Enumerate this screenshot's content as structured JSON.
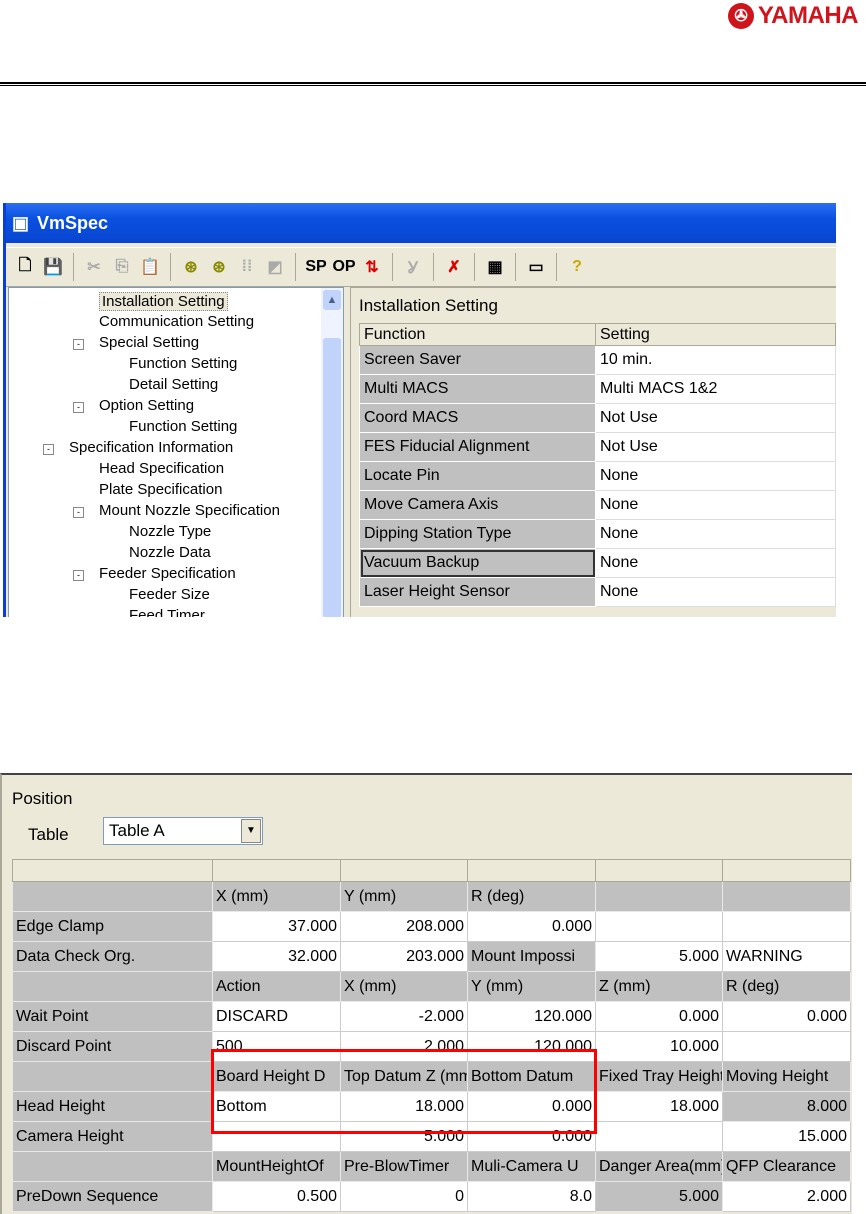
{
  "logo": {
    "text": "YAMAHA"
  },
  "window": {
    "title": "VmSpec"
  },
  "toolbar": {
    "sp": "SP",
    "op": "OP"
  },
  "tree": [
    {
      "label": "Installation Setting",
      "level": 2,
      "selected": true
    },
    {
      "label": "Communication Setting",
      "level": 2
    },
    {
      "label": "Special Setting",
      "level": 2,
      "expander": "-"
    },
    {
      "label": "Function Setting",
      "level": 3
    },
    {
      "label": "Detail Setting",
      "level": 3
    },
    {
      "label": "Option Setting",
      "level": 2,
      "expander": "-"
    },
    {
      "label": "Function Setting",
      "level": 3
    },
    {
      "label": "Specification Information",
      "level": 1,
      "expander": "-"
    },
    {
      "label": "Head Specification",
      "level": 2
    },
    {
      "label": "Plate Specification",
      "level": 2
    },
    {
      "label": "Mount Nozzle Specification",
      "level": 2,
      "expander": "-"
    },
    {
      "label": "Nozzle Type",
      "level": 3
    },
    {
      "label": "Nozzle Data",
      "level": 3
    },
    {
      "label": "Feeder Specification",
      "level": 2,
      "expander": "-"
    },
    {
      "label": "Feeder Size",
      "level": 3
    },
    {
      "label": "Feed Timer",
      "level": 3
    }
  ],
  "settings": {
    "title": "Installation Setting",
    "headers": [
      "Function",
      "Setting"
    ],
    "rows": [
      [
        "Screen Saver",
        "10 min."
      ],
      [
        "Multi MACS",
        "Multi MACS 1&2"
      ],
      [
        "Coord MACS",
        "Not Use"
      ],
      [
        "FES Fiducial Alignment",
        "Not Use"
      ],
      [
        "Locate Pin",
        "None"
      ],
      [
        "Move Camera Axis",
        "None"
      ],
      [
        "Dipping Station Type",
        "None"
      ],
      [
        "Vacuum Backup",
        "None"
      ],
      [
        "Laser Height Sensor",
        "None"
      ]
    ]
  },
  "position": {
    "title": "Position",
    "table_label": "Table",
    "table_value": "Table A",
    "grid": [
      [
        [
          "",
          "g"
        ],
        [
          "X (mm)",
          "g"
        ],
        [
          "Y (mm)",
          "g"
        ],
        [
          "R (deg)",
          "g"
        ],
        [
          "",
          "g"
        ],
        [
          "",
          "g"
        ]
      ],
      [
        [
          "Edge Clamp",
          "g"
        ],
        [
          "37.000",
          "wr"
        ],
        [
          "208.000",
          "wr"
        ],
        [
          "0.000",
          "wr"
        ],
        [
          "",
          "w"
        ],
        [
          "",
          "w"
        ]
      ],
      [
        [
          "Data Check Org.",
          "g"
        ],
        [
          "32.000",
          "wr"
        ],
        [
          "203.000",
          "wr"
        ],
        [
          "Mount Impossi",
          "g"
        ],
        [
          "5.000",
          "wr"
        ],
        [
          "WARNING",
          "w"
        ]
      ],
      [
        [
          "",
          "g"
        ],
        [
          "Action",
          "g"
        ],
        [
          "X (mm)",
          "g"
        ],
        [
          "Y (mm)",
          "g"
        ],
        [
          "Z (mm)",
          "g"
        ],
        [
          "R (deg)",
          "g"
        ]
      ],
      [
        [
          "Wait Point",
          "g"
        ],
        [
          "DISCARD",
          "w"
        ],
        [
          "-2.000",
          "wr"
        ],
        [
          "120.000",
          "wr"
        ],
        [
          "0.000",
          "wr"
        ],
        [
          "0.000",
          "wr"
        ]
      ],
      [
        [
          "Discard Point",
          "g"
        ],
        [
          "500",
          "w"
        ],
        [
          "2.000",
          "wr"
        ],
        [
          "120.000",
          "wr"
        ],
        [
          "10.000",
          "wr"
        ],
        [
          "",
          "w"
        ]
      ],
      [
        [
          "",
          "g"
        ],
        [
          "Board Height D",
          "g"
        ],
        [
          "Top Datum Z (mm)",
          "g"
        ],
        [
          "Bottom Datum",
          "g"
        ],
        [
          "Fixed Tray Height",
          "g"
        ],
        [
          "Moving Height",
          "g"
        ]
      ],
      [
        [
          "Head Height",
          "g"
        ],
        [
          "Bottom",
          "w"
        ],
        [
          "18.000",
          "wr"
        ],
        [
          "0.000",
          "wr"
        ],
        [
          "18.000",
          "wr"
        ],
        [
          "8.000",
          "gr"
        ]
      ],
      [
        [
          "Camera Height",
          "g"
        ],
        [
          "",
          "w"
        ],
        [
          "5.000",
          "wr"
        ],
        [
          "0.000",
          "wr"
        ],
        [
          "",
          "w"
        ],
        [
          "15.000",
          "wr"
        ]
      ],
      [
        [
          "",
          "g"
        ],
        [
          "MountHeightOf",
          "g"
        ],
        [
          "Pre-BlowTimer",
          "g"
        ],
        [
          "Muli-Camera U",
          "g"
        ],
        [
          "Danger Area(mm)",
          "g"
        ],
        [
          "QFP Clearance",
          "g"
        ]
      ],
      [
        [
          "PreDown Sequence",
          "g"
        ],
        [
          "0.500",
          "wr"
        ],
        [
          "0",
          "wr"
        ],
        [
          "8.0",
          "wr"
        ],
        [
          "5.000",
          "gr"
        ],
        [
          "2.000",
          "wr"
        ]
      ]
    ]
  }
}
